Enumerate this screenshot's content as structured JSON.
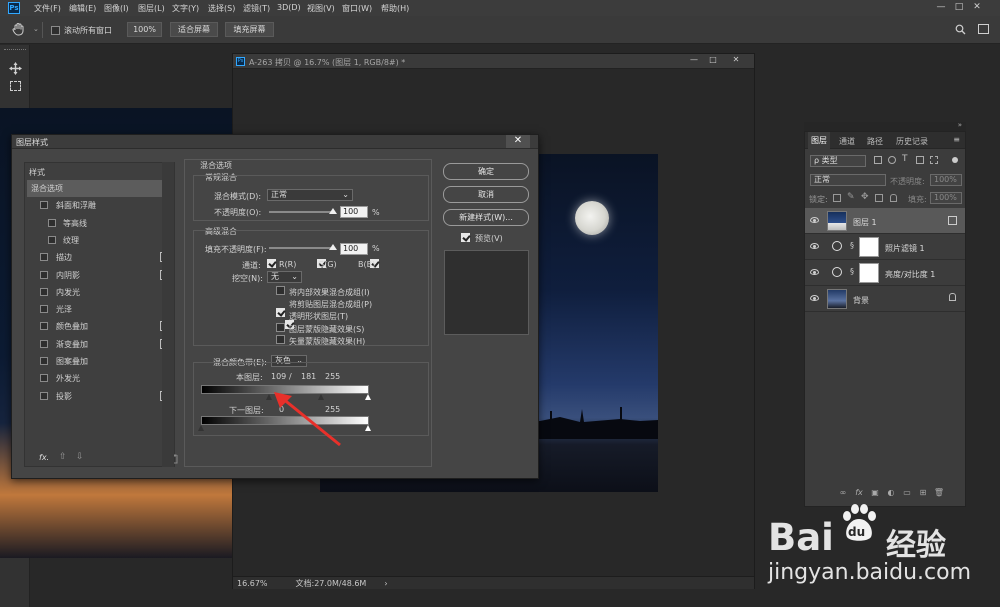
{
  "menubar": {
    "logo": "Ps",
    "items": [
      "文件(F)",
      "编辑(E)",
      "图像(I)",
      "图层(L)",
      "文字(Y)",
      "选择(S)",
      "滤镜(T)",
      "3D(D)",
      "视图(V)",
      "窗口(W)",
      "帮助(H)"
    ],
    "win_min": "—",
    "win_max": "□",
    "win_close": "✕"
  },
  "options": {
    "scroll_all_label": "滚动所有窗口",
    "zoom_value": "100%",
    "fit_screen": "适合屏幕",
    "fill_screen": "填充屏幕"
  },
  "document": {
    "title": "A-263 拷贝 @ 16.7% (图层 1, RGB/8#) *",
    "zoom": "16.67%",
    "doc_size": "文档:27.0M/48.6M",
    "status_arrow": "›"
  },
  "dialog": {
    "title": "图层样式",
    "close": "✕",
    "styles_header": "样式",
    "styles": [
      {
        "label": "混合选项",
        "checkbox": false,
        "plus": false,
        "selected": true,
        "indent": 0
      },
      {
        "label": "斜面和浮雕",
        "checkbox": true,
        "checked": false,
        "plus": false,
        "indent": 0
      },
      {
        "label": "等高线",
        "checkbox": true,
        "checked": false,
        "plus": false,
        "indent": 1
      },
      {
        "label": "纹理",
        "checkbox": true,
        "checked": false,
        "plus": false,
        "indent": 1
      },
      {
        "label": "描边",
        "checkbox": true,
        "checked": false,
        "plus": true,
        "indent": 0
      },
      {
        "label": "内阴影",
        "checkbox": true,
        "checked": false,
        "plus": true,
        "indent": 0
      },
      {
        "label": "内发光",
        "checkbox": true,
        "checked": false,
        "plus": false,
        "indent": 0
      },
      {
        "label": "光泽",
        "checkbox": true,
        "checked": false,
        "plus": false,
        "indent": 0
      },
      {
        "label": "颜色叠加",
        "checkbox": true,
        "checked": false,
        "plus": true,
        "indent": 0
      },
      {
        "label": "渐变叠加",
        "checkbox": true,
        "checked": false,
        "plus": true,
        "indent": 0
      },
      {
        "label": "图案叠加",
        "checkbox": true,
        "checked": false,
        "plus": false,
        "indent": 0
      },
      {
        "label": "外发光",
        "checkbox": true,
        "checked": false,
        "plus": false,
        "indent": 0
      },
      {
        "label": "投影",
        "checkbox": true,
        "checked": false,
        "plus": true,
        "indent": 0
      }
    ],
    "footer_fx": "fx.",
    "blend": {
      "header": "混合选项",
      "general_header": "常规混合",
      "mode_label": "混合模式(D):",
      "mode_value": "正常",
      "opacity_label": "不透明度(O):",
      "opacity_value": "100",
      "opacity_unit": "%",
      "advanced_header": "高级混合",
      "fill_label": "填充不透明度(F):",
      "fill_value": "100",
      "fill_unit": "%",
      "channels_label": "通道:",
      "channel_r": "R(R)",
      "channel_g": "G(G)",
      "channel_b": "B(B)",
      "knockout_label": "挖空(N):",
      "knockout_value": "无",
      "options": [
        {
          "label": "将内部效果混合成组(I)",
          "checked": false
        },
        {
          "label": "将剪贴图层混合成组(P)",
          "checked": true
        },
        {
          "label": "透明形状图层(T)",
          "checked": true
        },
        {
          "label": "图层蒙版隐藏效果(S)",
          "checked": false
        },
        {
          "label": "矢量蒙版隐藏效果(H)",
          "checked": false
        }
      ],
      "blend_if_label": "混合颜色带(E):",
      "blend_if_value": "灰色",
      "this_layer_label": "本图层:",
      "this_layer_values": {
        "low": "109",
        "sep": "/",
        "mid": "181",
        "high": "255"
      },
      "under_layer_label": "下一图层:",
      "under_layer_values": {
        "low": "0",
        "high": "255"
      }
    },
    "buttons": {
      "ok": "确定",
      "cancel": "取消",
      "new_style": "新建样式(W)...",
      "preview": "预览(V)"
    }
  },
  "layers_panel": {
    "tabs": [
      "图层",
      "通道",
      "路径",
      "历史记录"
    ],
    "kind_label": "ρ 类型",
    "mode_value": "正常",
    "opacity_label": "不透明度:",
    "opacity_value": "100%",
    "lock_label": "锁定:",
    "fill_label": "填充:",
    "fill_value": "100%",
    "layers": [
      {
        "name": "图层 1",
        "selected": true,
        "type": "pixel"
      },
      {
        "name": "照片滤镜 1",
        "selected": false,
        "type": "adjust"
      },
      {
        "name": "亮度/对比度 1",
        "selected": false,
        "type": "adjust"
      },
      {
        "name": "背景",
        "selected": false,
        "type": "background"
      }
    ],
    "footer_icons": [
      "link-icon",
      "fx-icon",
      "mask-icon",
      "adjustment-icon",
      "group-icon",
      "new-layer-icon",
      "trash-icon"
    ],
    "footer_fx": "fx"
  },
  "watermark": {
    "brand": "Bai",
    "paw": "du",
    "cn": "经验",
    "url": "jingyan.baidu.com"
  },
  "colors": {
    "accent": "#31a8ff",
    "arrow": "#e8302a",
    "panel": "#3c3c3c",
    "dialog": "#454545"
  }
}
